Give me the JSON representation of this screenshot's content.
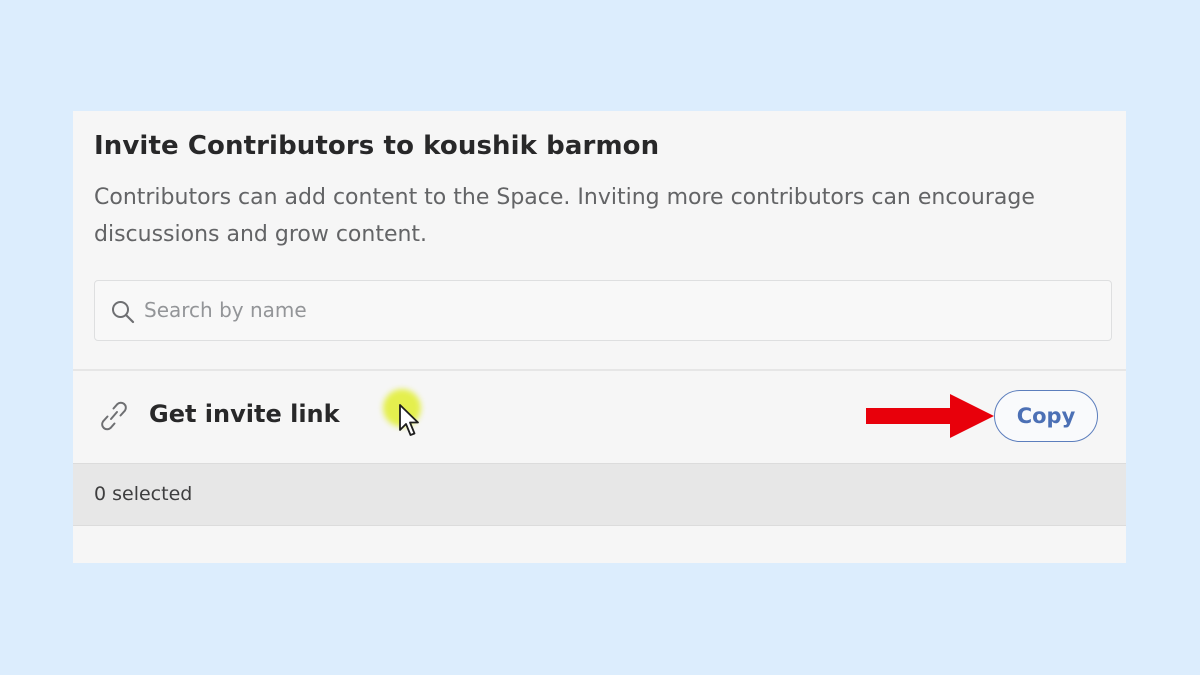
{
  "dialog": {
    "title": "Invite Contributors to koushik barmon",
    "description": "Contributors can add content to the Space. Inviting more contributors can encourage discussions and grow content."
  },
  "search": {
    "placeholder": "Search by name",
    "value": "",
    "icon": "search-icon"
  },
  "invite_link": {
    "label": "Get invite link",
    "icon": "link-icon",
    "copy_label": "Copy"
  },
  "selection": {
    "count_label": "0 selected"
  },
  "colors": {
    "background": "#dcedfd",
    "panel": "#f6f6f6",
    "accent": "#4c70b5",
    "annotation_arrow": "#e8000b",
    "cursor_highlight": "#e2ee3c"
  }
}
